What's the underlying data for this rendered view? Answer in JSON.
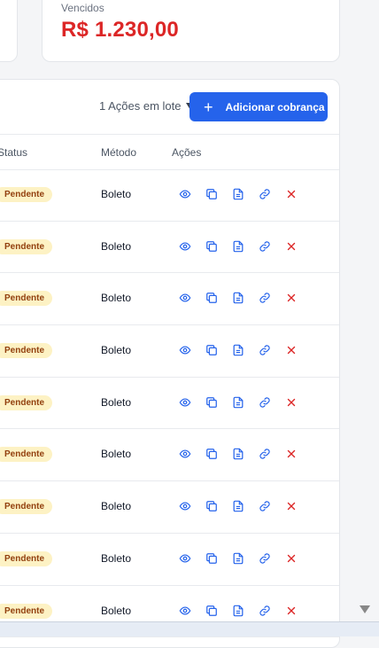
{
  "summary": {
    "overdue_label": "Vencidos",
    "overdue_value": "R$ 1.230,00"
  },
  "toolbar": {
    "bulk_actions_label": "1 Ações em lote",
    "add_button_label": "Adicionar cobrança"
  },
  "table": {
    "headers": {
      "status": "Status",
      "method": "Método",
      "actions": "Ações"
    },
    "rows": [
      {
        "status": "Pendente",
        "method": "Boleto"
      },
      {
        "status": "Pendente",
        "method": "Boleto"
      },
      {
        "status": "Pendente",
        "method": "Boleto"
      },
      {
        "status": "Pendente",
        "method": "Boleto"
      },
      {
        "status": "Pendente",
        "method": "Boleto"
      },
      {
        "status": "Pendente",
        "method": "Boleto"
      },
      {
        "status": "Pendente",
        "method": "Boleto"
      },
      {
        "status": "Pendente",
        "method": "Boleto"
      },
      {
        "status": "Pendente",
        "method": "Boleto"
      }
    ],
    "action_icons": [
      "view-icon",
      "copy-icon",
      "document-icon",
      "link-icon",
      "delete-icon"
    ]
  },
  "colors": {
    "primary": "#2563eb",
    "danger": "#dc2626",
    "pending_badge_bg": "#fdf2c4",
    "pending_badge_text": "#92400e"
  }
}
